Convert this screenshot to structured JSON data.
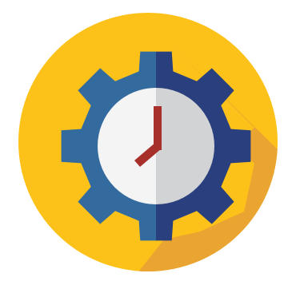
{
  "icon": {
    "name": "gear-clock-icon",
    "colors": {
      "background": "#FFFFFF",
      "circle": "#FDC21A",
      "long_shadow": "#EAA431",
      "gear_light": "#346B9F",
      "gear_dark": "#2A3F7E",
      "face_light": "#F4F4F4",
      "face_dark": "#D2D3D5",
      "hands": "#A7312A"
    }
  }
}
